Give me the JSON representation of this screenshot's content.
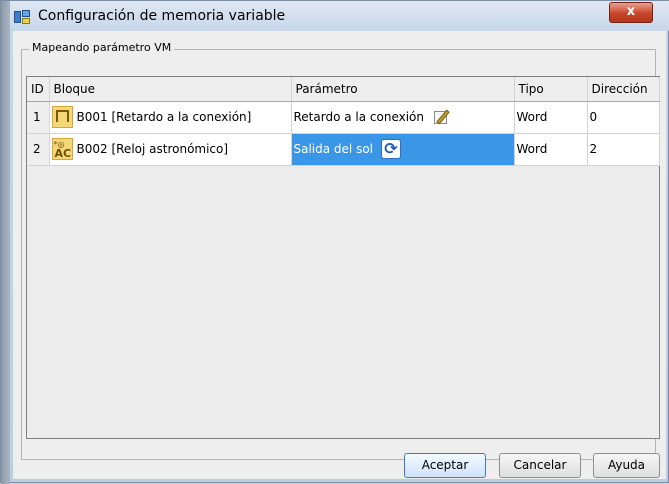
{
  "window": {
    "title": "Configuración de memoria variable",
    "close_label": "x"
  },
  "group": {
    "legend": "Mapeando parámetro VM"
  },
  "table": {
    "columns": [
      "ID",
      "Bloque",
      "Parámetro",
      "Tipo",
      "Dirección"
    ],
    "rows": [
      {
        "id": "1",
        "bloque": "B001 [Retardo a la conexión]",
        "bloque_icon": "on-delay-pulse-icon",
        "parametro": "Retardo a la conexión",
        "param_icon": "edit-icon",
        "tipo": "Word",
        "direccion": "0",
        "selected": false
      },
      {
        "id": "2",
        "bloque": "B002 [Reloj astronómico]",
        "bloque_icon": "astronomical-clock-icon",
        "bloque_icon_text": [
          "*◎",
          "AC"
        ],
        "parametro": "Salida del sol",
        "param_icon": "refresh-icon",
        "tipo": "Word",
        "direccion": "2",
        "selected": true
      }
    ]
  },
  "buttons": {
    "accept": "Aceptar",
    "cancel": "Cancelar",
    "help": "Ayuda"
  },
  "colors": {
    "selection": "#3a96e6",
    "block_icon_bg": "#f3d779",
    "close_button": "#c7462b"
  }
}
